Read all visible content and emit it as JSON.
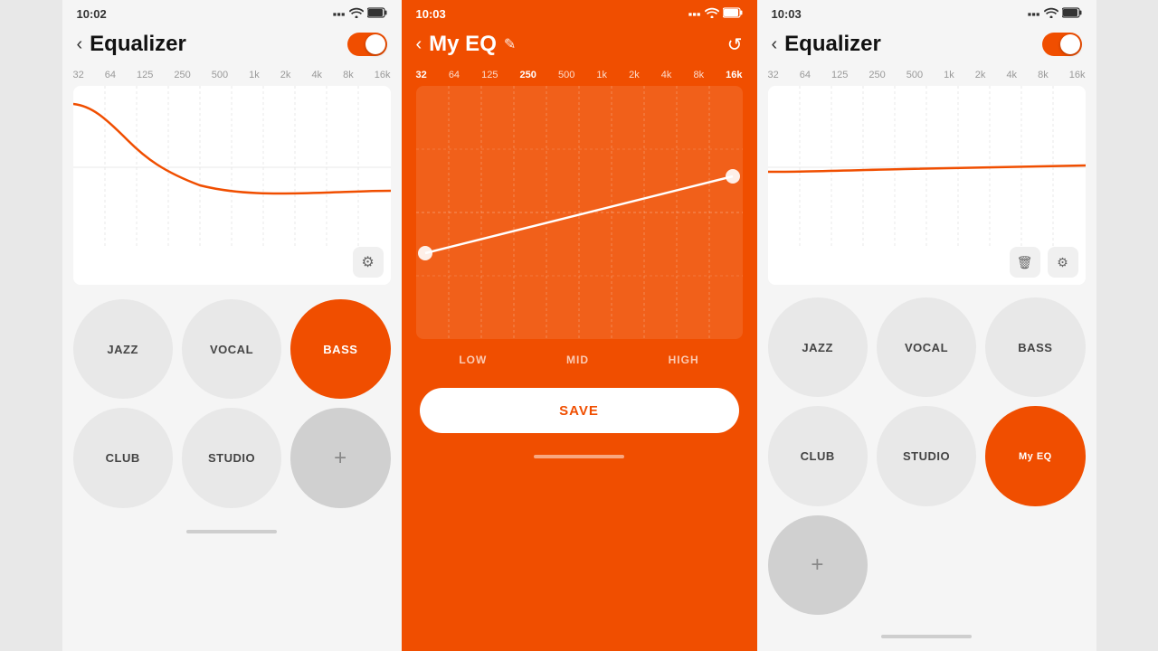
{
  "screens": [
    {
      "id": "screen1",
      "theme": "light",
      "statusBar": {
        "time": "10:02",
        "signal": "▪▪▪",
        "wifi": "wifi",
        "battery": "battery"
      },
      "header": {
        "back": "<",
        "title": "Equalizer",
        "toggle": true
      },
      "freqLabels": [
        "32",
        "64",
        "125",
        "250",
        "500",
        "1k",
        "2k",
        "4k",
        "8k",
        "16k"
      ],
      "presets": [
        {
          "id": "jazz",
          "label": "JAZZ",
          "active": false
        },
        {
          "id": "vocal",
          "label": "VOCAL",
          "active": false
        },
        {
          "id": "bass",
          "label": "BASS",
          "active": true
        },
        {
          "id": "club",
          "label": "CLUB",
          "active": false
        },
        {
          "id": "studio",
          "label": "STUDIO",
          "active": false
        },
        {
          "id": "add",
          "label": "+",
          "active": false
        }
      ]
    },
    {
      "id": "screen2",
      "theme": "dark",
      "statusBar": {
        "time": "10:03",
        "signal": "▪▪▪",
        "wifi": "wifi",
        "battery": "battery"
      },
      "header": {
        "back": "<",
        "title": "My EQ",
        "reset": "↺"
      },
      "freqLabels": [
        "32",
        "64",
        "125",
        "250",
        "500",
        "1k",
        "2k",
        "4k",
        "8k",
        "16k"
      ],
      "activeFreqs": [
        "32",
        "250",
        "16k"
      ],
      "bandLabels": [
        "LOW",
        "MID",
        "HIGH"
      ],
      "saveLabel": "SAVE"
    },
    {
      "id": "screen3",
      "theme": "light",
      "statusBar": {
        "time": "10:03",
        "signal": "▪▪▪",
        "wifi": "wifi",
        "battery": "battery"
      },
      "header": {
        "back": "<",
        "title": "Equalizer",
        "toggle": true
      },
      "freqLabels": [
        "32",
        "64",
        "125",
        "250",
        "500",
        "1k",
        "2k",
        "4k",
        "8k",
        "16k"
      ],
      "presets": [
        {
          "id": "jazz",
          "label": "JAZZ",
          "active": false
        },
        {
          "id": "vocal",
          "label": "VOCAL",
          "active": false
        },
        {
          "id": "bass",
          "label": "BASS",
          "active": false
        },
        {
          "id": "club",
          "label": "CLUB",
          "active": false
        },
        {
          "id": "studio",
          "label": "STUDIO",
          "active": false
        },
        {
          "id": "myeq",
          "label": "My EQ",
          "active": true
        },
        {
          "id": "add",
          "label": "+",
          "active": false
        }
      ]
    }
  ]
}
